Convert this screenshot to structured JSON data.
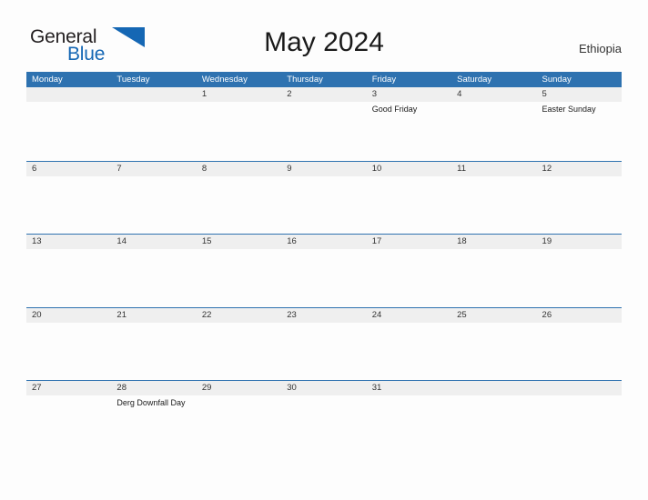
{
  "brand": {
    "name_part1": "General",
    "name_part2": "Blue",
    "flag_icon": "blue-flag-triangle-icon"
  },
  "header": {
    "title": "May 2024",
    "country": "Ethiopia"
  },
  "colors": {
    "header_blue": "#2e72b0",
    "row_line_blue": "#2e72b0",
    "band_gray": "#efefef",
    "logo_blue": "#1567b4",
    "page_background": "#fdfdfd"
  },
  "calendar": {
    "weekdays": [
      "Monday",
      "Tuesday",
      "Wednesday",
      "Thursday",
      "Friday",
      "Saturday",
      "Sunday"
    ],
    "weeks": [
      [
        {
          "day": "",
          "event": ""
        },
        {
          "day": "",
          "event": ""
        },
        {
          "day": "1",
          "event": ""
        },
        {
          "day": "2",
          "event": ""
        },
        {
          "day": "3",
          "event": "Good Friday"
        },
        {
          "day": "4",
          "event": ""
        },
        {
          "day": "5",
          "event": "Easter Sunday"
        }
      ],
      [
        {
          "day": "6",
          "event": ""
        },
        {
          "day": "7",
          "event": ""
        },
        {
          "day": "8",
          "event": ""
        },
        {
          "day": "9",
          "event": ""
        },
        {
          "day": "10",
          "event": ""
        },
        {
          "day": "11",
          "event": ""
        },
        {
          "day": "12",
          "event": ""
        }
      ],
      [
        {
          "day": "13",
          "event": ""
        },
        {
          "day": "14",
          "event": ""
        },
        {
          "day": "15",
          "event": ""
        },
        {
          "day": "16",
          "event": ""
        },
        {
          "day": "17",
          "event": ""
        },
        {
          "day": "18",
          "event": ""
        },
        {
          "day": "19",
          "event": ""
        }
      ],
      [
        {
          "day": "20",
          "event": ""
        },
        {
          "day": "21",
          "event": ""
        },
        {
          "day": "22",
          "event": ""
        },
        {
          "day": "23",
          "event": ""
        },
        {
          "day": "24",
          "event": ""
        },
        {
          "day": "25",
          "event": ""
        },
        {
          "day": "26",
          "event": ""
        }
      ],
      [
        {
          "day": "27",
          "event": ""
        },
        {
          "day": "28",
          "event": "Derg Downfall Day"
        },
        {
          "day": "29",
          "event": ""
        },
        {
          "day": "30",
          "event": ""
        },
        {
          "day": "31",
          "event": ""
        },
        {
          "day": "",
          "event": ""
        },
        {
          "day": "",
          "event": ""
        }
      ]
    ]
  }
}
